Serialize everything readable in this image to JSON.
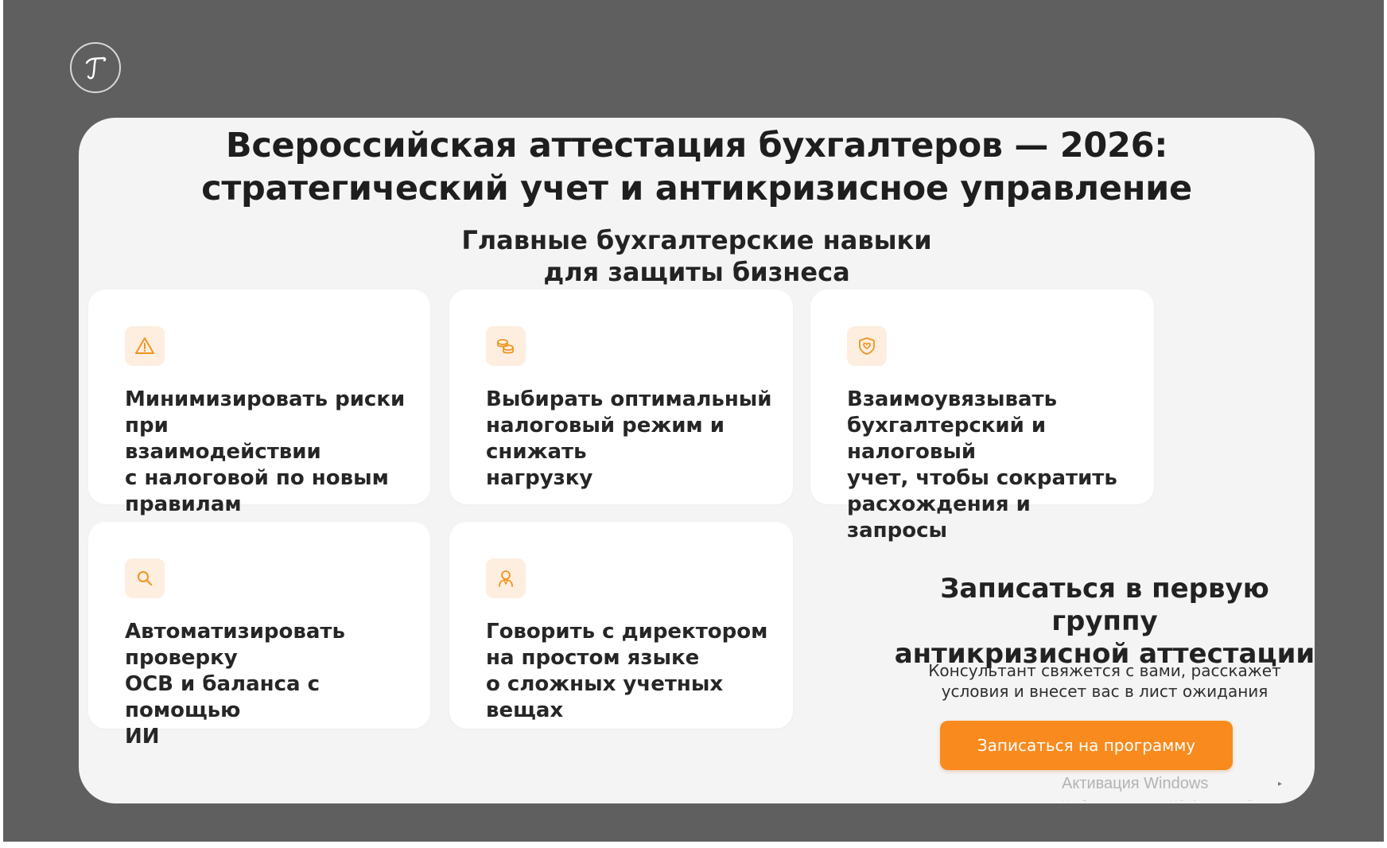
{
  "title": "Всероссийская аттестация бухгалтеров — 2026: стратегический учет и антикризисное управление",
  "subtitle": "Главные бухгалтерские навыки\nдля защиты бизнеса",
  "colors": {
    "accent": "#f98a1d",
    "icon_bg": "#fdeee0",
    "backdrop": "#5f5f5f",
    "card": "#f4f4f4"
  },
  "skills": [
    {
      "icon": "warning-icon",
      "text": "Минимизировать риски при\nвзаимодействии\nс налоговой по новым\nправилам"
    },
    {
      "icon": "coins-icon",
      "text": "Выбирать оптимальный\nналоговый режим и снижать\nнагрузку"
    },
    {
      "icon": "shield-icon",
      "text": "Взаимоувязывать\nбухгалтерский и налоговый\nучет, чтобы сократить\nрасхождения и запросы"
    },
    {
      "icon": "search-icon",
      "text": "Автоматизировать проверку\nОСВ и баланса с помощью\nИИ"
    },
    {
      "icon": "person-icon",
      "text": "Говорить с директором\nна простом языке\nо сложных учетных вещах"
    }
  ],
  "cta": {
    "title": "Записаться в первую группу\nантикризисной аттестации",
    "description": "Консультант свяжется с вами, расскажет\nусловия и внесет вас в лист ожидания",
    "button_label": "Записаться на программу"
  },
  "watermark": {
    "line1": "Активация Windows",
    "line2": "Чтобы активировать Windows, перейдите"
  }
}
